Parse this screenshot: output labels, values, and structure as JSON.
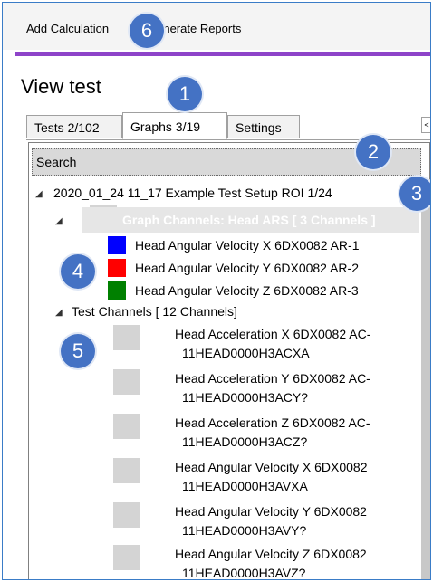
{
  "menu": {
    "add_calculation": "Add Calculation",
    "generate_reports": "Generate Reports"
  },
  "page_title": "View test",
  "tabs": [
    {
      "label": "Tests 2/102",
      "active": false
    },
    {
      "label": "Graphs 3/19",
      "active": true
    },
    {
      "label": "Settings",
      "active": false
    }
  ],
  "tabs_scroll_glyph": "<",
  "search": {
    "placeholder": "Search"
  },
  "tree": {
    "root_label": "2020_01_24 11_17 Example Test Setup ROI 1/24",
    "graph_group": {
      "label": "Graph Channels: Head ARS [ 3 Channels ]"
    },
    "graph_items": [
      {
        "label": "Head Angular Velocity X 6DX0082 AR-1",
        "color": "#0000ff"
      },
      {
        "label": "Head Angular Velocity Y 6DX0082 AR-2",
        "color": "#ff0000"
      },
      {
        "label": "Head Angular Velocity Z 6DX0082 AR-3",
        "color": "#008000"
      }
    ],
    "test_group": {
      "label": "Test Channels [ 12 Channels]"
    },
    "test_items": [
      {
        "line1": "Head Acceleration X 6DX0082 AC-",
        "line2": "11HEAD0000H3ACXA"
      },
      {
        "line1": "Head Acceleration Y 6DX0082 AC-",
        "line2": "11HEAD0000H3ACY?"
      },
      {
        "line1": "Head Acceleration Z 6DX0082 AC-",
        "line2": "11HEAD0000H3ACZ?"
      },
      {
        "line1": "Head Angular Velocity X 6DX0082",
        "line2": "11HEAD0000H3AVXA"
      },
      {
        "line1": "Head Angular Velocity Y 6DX0082",
        "line2": "11HEAD0000H3AVY?"
      },
      {
        "line1": "Head Angular Velocity Z 6DX0082",
        "line2": "11HEAD0000H3AVZ?"
      }
    ]
  },
  "badges": [
    "1",
    "2",
    "3",
    "4",
    "5",
    "6"
  ],
  "colors": {
    "accent_bar": "#8e44c9",
    "badge": "#4472c4",
    "frame_border": "#3a7cc7"
  }
}
